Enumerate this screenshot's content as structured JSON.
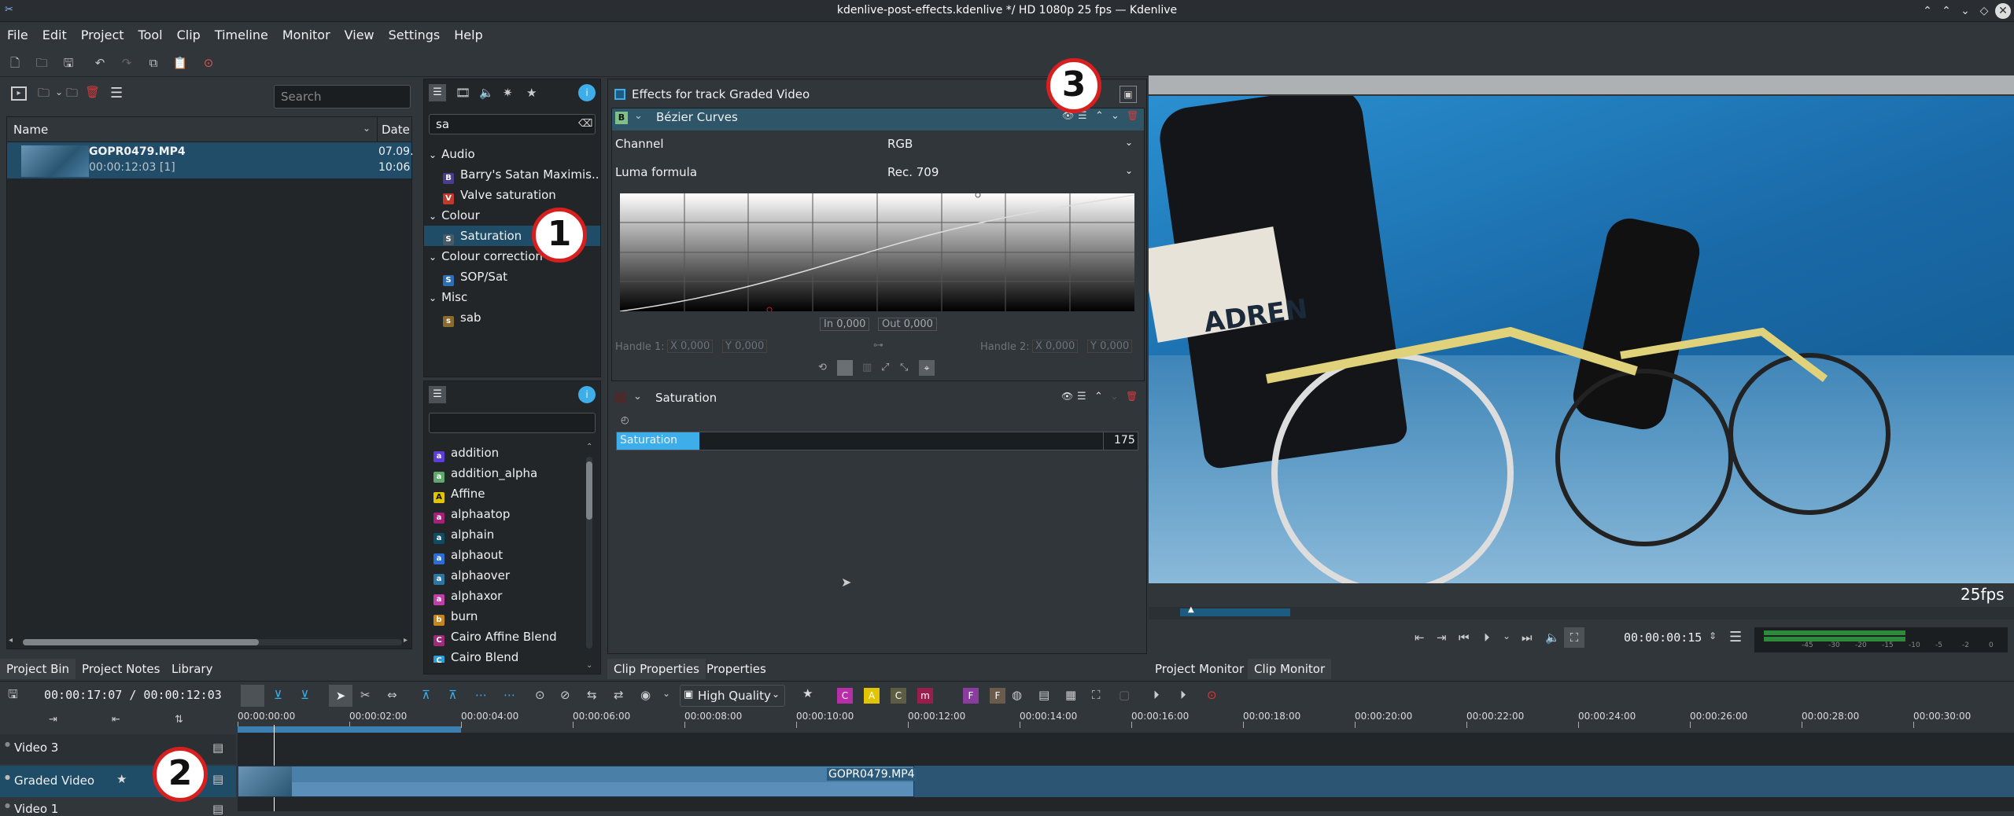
{
  "window": {
    "title": "kdenlive-post-effects.kdenlive */ HD 1080p 25 fps — Kdenlive"
  },
  "menu": [
    "File",
    "Edit",
    "Project",
    "Tool",
    "Clip",
    "Timeline",
    "Monitor",
    "View",
    "Settings",
    "Help"
  ],
  "bin": {
    "search_placeholder": "Search",
    "col_name": "Name",
    "col_date": "Date",
    "clip": {
      "name": "GOPR0479.MP4",
      "duration": "00:00:12:03 [1]",
      "date1": "07.09.",
      "date2": "10:06"
    }
  },
  "left_tabs": [
    "Project Bin",
    "Project Notes",
    "Library"
  ],
  "effects_list": {
    "search_value": "sa",
    "groups": [
      {
        "name": "Audio",
        "items": [
          {
            "label": "Barry's Satan Maximis...",
            "letter": "B",
            "color": "#4a3c8e"
          },
          {
            "label": "Valve saturation",
            "letter": "V",
            "color": "#c0392b"
          }
        ]
      },
      {
        "name": "Colour",
        "items": [
          {
            "label": "Saturation",
            "letter": "S",
            "color": "#4a5968"
          }
        ]
      },
      {
        "name": "Colour correction",
        "items": [
          {
            "label": "SOP/Sat",
            "letter": "S",
            "color": "#2d6fb5"
          }
        ]
      },
      {
        "name": "Misc",
        "items": [
          {
            "label": "sab",
            "letter": "s",
            "color": "#8a6a2e"
          }
        ]
      }
    ]
  },
  "transitions": {
    "items": [
      {
        "label": "addition",
        "letter": "a",
        "color": "#5e3ed6"
      },
      {
        "label": "addition_alpha",
        "letter": "a",
        "color": "#5fa86b"
      },
      {
        "label": "Affine",
        "letter": "A",
        "color": "#e2c400"
      },
      {
        "label": "alphaatop",
        "letter": "a",
        "color": "#a6207a"
      },
      {
        "label": "alphain",
        "letter": "a",
        "color": "#0f4d66"
      },
      {
        "label": "alphaout",
        "letter": "a",
        "color": "#2b6dd6"
      },
      {
        "label": "alphaover",
        "letter": "a",
        "color": "#2b76a5"
      },
      {
        "label": "alphaxor",
        "letter": "a",
        "color": "#c23fa9"
      },
      {
        "label": "burn",
        "letter": "b",
        "color": "#c8861a"
      },
      {
        "label": "Cairo Affine Blend",
        "letter": "C",
        "color": "#a02b7a"
      },
      {
        "label": "Cairo Blend",
        "letter": "C",
        "color": "#2b9ed6"
      }
    ]
  },
  "effect_stack": {
    "title": "Effects for track Graded Video",
    "bezier": {
      "name": "Bézier Curves",
      "channel_label": "Channel",
      "channel_value": "RGB",
      "luma_label": "Luma formula",
      "luma_value": "Rec. 709",
      "in_label": "In",
      "in_value": "0,000",
      "out_label": "Out",
      "out_value": "0,000",
      "h1_label": "Handle 1:",
      "h2_label": "Handle 2:",
      "x": "X",
      "y": "Y",
      "zero": "0,000"
    },
    "saturation": {
      "name": "Saturation",
      "param": "Saturation",
      "value": "175",
      "fraction": 0.17
    }
  },
  "mid_tabs": [
    "Clip Properties",
    "Properties"
  ],
  "monitor": {
    "fps": "25fps",
    "timecode": "00:00:00:15",
    "tabs": [
      "Project Monitor",
      "Clip Monitor"
    ],
    "vu_labels": [
      "-45",
      "-30",
      "-20",
      "-15",
      "-10",
      "-5",
      "-2",
      "0"
    ]
  },
  "timeline": {
    "timecode": "00:00:17:07 / 00:00:12:03",
    "quality": "High Quality",
    "ruler": [
      "00:00:00:00",
      "00:00:02:00",
      "00:00:04:00",
      "00:00:06:00",
      "00:00:08:00",
      "00:00:10:00",
      "00:00:12:00",
      "00:00:14:00",
      "00:00:16:00",
      "00:00:18:00",
      "00:00:20:00",
      "00:00:22:00",
      "00:00:24:00",
      "00:00:26:00",
      "00:00:28:00",
      "00:00:30:00"
    ],
    "tracks": [
      "Video 3",
      "Graded Video",
      "Video 1"
    ],
    "clip_name": "GOPR0479.MP4",
    "markers": [
      {
        "l": "C",
        "c": "#b82ea8"
      },
      {
        "l": "A",
        "c": "#e2c400"
      },
      {
        "l": "C",
        "c": "#5d5d44"
      },
      {
        "l": "m",
        "c": "#9b1d4b"
      },
      {
        "l": "F",
        "c": "#8a3d9e"
      },
      {
        "l": "F",
        "c": "#6b5b4a"
      }
    ]
  },
  "badges": [
    "1",
    "2",
    "3"
  ]
}
